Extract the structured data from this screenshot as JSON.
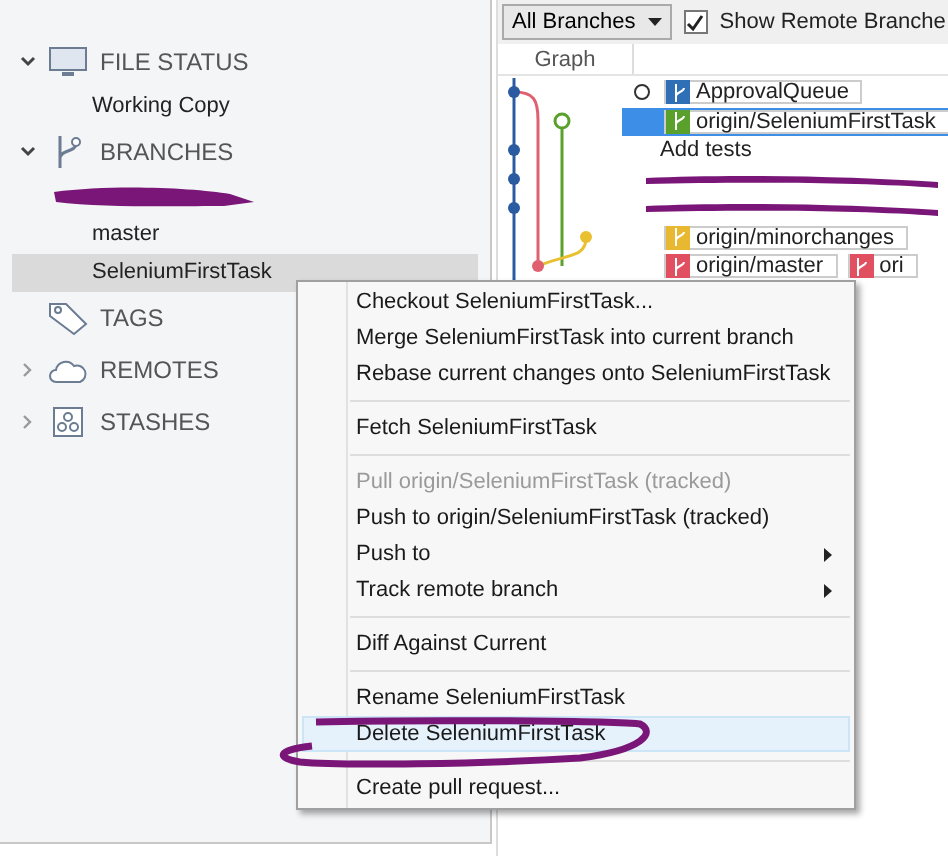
{
  "sidebar": {
    "sections": [
      {
        "label": "FILE STATUS",
        "kind": "expanded",
        "items": [
          {
            "kind": "branch",
            "label": "Working Copy",
            "selected": false
          }
        ]
      },
      {
        "label": "BRANCHES",
        "kind": "expanded",
        "items": [
          {
            "kind": "redacted",
            "selected": false
          },
          {
            "kind": "branch",
            "label": "master",
            "selected": false
          },
          {
            "kind": "branch",
            "label": "SeleniumFirstTask",
            "selected": true
          }
        ]
      },
      {
        "label": "TAGS",
        "kind": "leaf"
      },
      {
        "label": "REMOTES",
        "kind": "collapsed"
      },
      {
        "label": "STASHES",
        "kind": "collapsed"
      }
    ]
  },
  "toolbar": {
    "branch_filter": "All Branches",
    "show_remote": {
      "label": "Show Remote Branche",
      "checked": true
    }
  },
  "graph": {
    "column": "Graph",
    "rows": [
      {
        "kind": "refs",
        "selected": false,
        "head": true,
        "refs": [
          {
            "label": "ApprovalQueue",
            "color": "#2f6fb5"
          }
        ]
      },
      {
        "kind": "refs",
        "selected": true,
        "head": false,
        "refs": [
          {
            "label": "origin/SeleniumFirstTask",
            "color": "#5aa02c"
          }
        ]
      },
      {
        "kind": "message",
        "selected": false,
        "message": "Add tests"
      },
      {
        "kind": "redacted",
        "selected": false
      },
      {
        "kind": "redacted",
        "selected": false
      },
      {
        "kind": "refs",
        "selected": false,
        "head": false,
        "refs": [
          {
            "label": "origin/minorchanges",
            "color": "#e8b830"
          }
        ]
      },
      {
        "kind": "refs",
        "selected": false,
        "head": false,
        "refs": [
          {
            "label": "origin/master",
            "color": "#e05060"
          },
          {
            "label": "ori",
            "color": "#e05060"
          }
        ]
      }
    ]
  },
  "context_menu": {
    "items": [
      {
        "kind": "item",
        "label": "Checkout SeleniumFirstTask...",
        "disabled": false,
        "submenu": false,
        "selected": false
      },
      {
        "kind": "item",
        "label": "Merge SeleniumFirstTask into current branch",
        "disabled": false,
        "submenu": false,
        "selected": false
      },
      {
        "kind": "item",
        "label": "Rebase current changes onto SeleniumFirstTask",
        "disabled": false,
        "submenu": false,
        "selected": false
      },
      {
        "kind": "separator"
      },
      {
        "kind": "item",
        "label": "Fetch SeleniumFirstTask",
        "disabled": false,
        "submenu": false,
        "selected": false
      },
      {
        "kind": "separator"
      },
      {
        "kind": "item",
        "label": "Pull origin/SeleniumFirstTask (tracked)",
        "disabled": true,
        "submenu": false,
        "selected": false
      },
      {
        "kind": "item",
        "label": "Push to origin/SeleniumFirstTask (tracked)",
        "disabled": false,
        "submenu": false,
        "selected": false
      },
      {
        "kind": "item",
        "label": "Push to",
        "disabled": false,
        "submenu": true,
        "selected": false
      },
      {
        "kind": "item",
        "label": "Track remote branch",
        "disabled": false,
        "submenu": true,
        "selected": false
      },
      {
        "kind": "separator"
      },
      {
        "kind": "item",
        "label": "Diff Against Current",
        "disabled": false,
        "submenu": false,
        "selected": false
      },
      {
        "kind": "separator"
      },
      {
        "kind": "item",
        "label": "Rename SeleniumFirstTask",
        "disabled": false,
        "submenu": false,
        "selected": false
      },
      {
        "kind": "item",
        "label": "Delete SeleniumFirstTask",
        "disabled": false,
        "submenu": false,
        "selected": true
      },
      {
        "kind": "separator"
      },
      {
        "kind": "item",
        "label": "Create pull request...",
        "disabled": false,
        "submenu": false,
        "selected": false
      }
    ]
  }
}
